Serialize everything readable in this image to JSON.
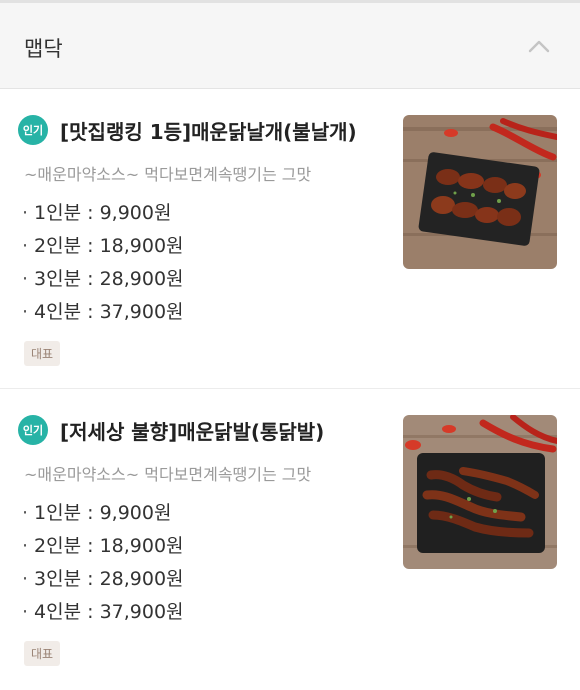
{
  "section": {
    "title": "맵닥",
    "toggle_icon": "chevron-up-icon"
  },
  "items": [
    {
      "badge": "인기",
      "title": "[맛집랭킹 1등]매운닭날개(불날개)",
      "description": "~매운마약소스~ 먹다보면계속땡기는 그맛",
      "prices": [
        "1인분 : 9,900원",
        "2인분 : 18,900원",
        "3인분 : 28,900원",
        "4인분 : 37,900원"
      ],
      "tag": "대표",
      "image": "spicy-chicken-wings-photo"
    },
    {
      "badge": "인기",
      "title": "[저세상 불향]매운닭발(통닭발)",
      "description": "~매운마약소스~ 먹다보면계속땡기는 그맛",
      "prices": [
        "1인분 : 9,900원",
        "2인분 : 18,900원",
        "3인분 : 28,900원",
        "4인분 : 37,900원"
      ],
      "tag": "대표",
      "image": "spicy-chicken-feet-photo"
    }
  ],
  "colors": {
    "badge": "#27b3a6",
    "header_bg": "#f6f6f6",
    "tag_bg": "#f1ece8"
  }
}
